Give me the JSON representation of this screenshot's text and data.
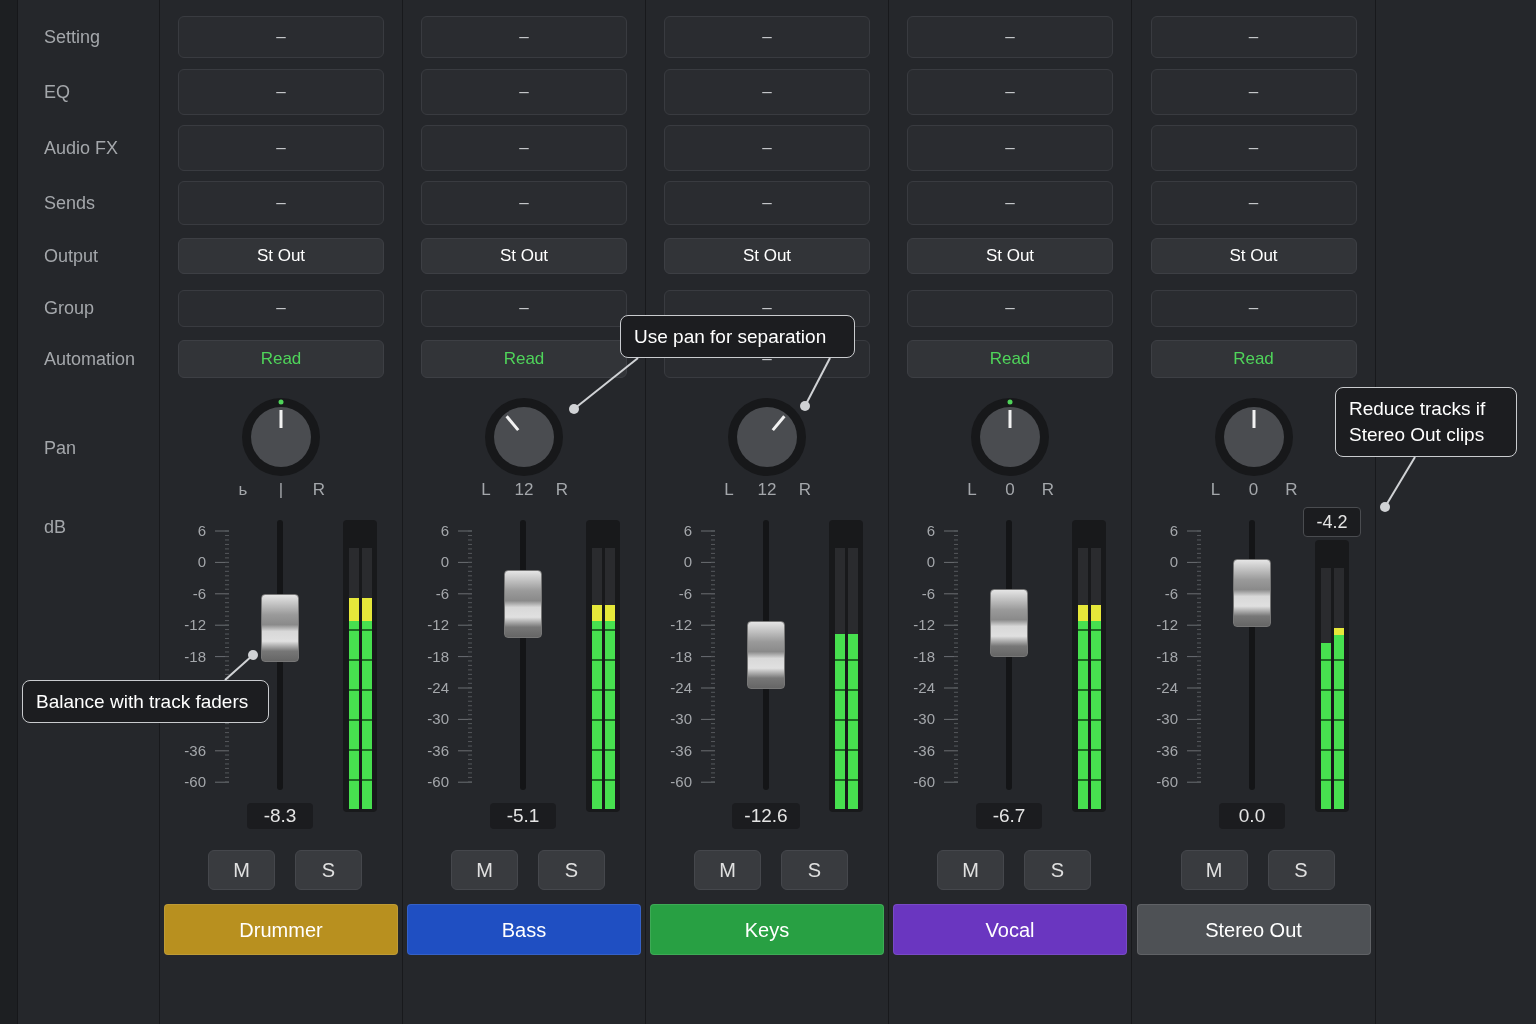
{
  "sidebar": {
    "labels": [
      "Setting",
      "EQ",
      "Audio FX",
      "Sends",
      "Output",
      "Group",
      "Automation",
      "Pan",
      "dB"
    ]
  },
  "channels": [
    {
      "name": "Drummer",
      "color": "#b8901f",
      "slots": [
        {
          "kind": "empty",
          "text": "–"
        },
        {
          "kind": "empty",
          "text": "–"
        },
        {
          "kind": "empty",
          "text": "–"
        },
        {
          "kind": "empty",
          "text": "–"
        },
        {
          "kind": "value",
          "text": "St Out"
        },
        {
          "kind": "empty",
          "text": "–"
        },
        {
          "kind": "automation",
          "text": "Read"
        }
      ],
      "pan": {
        "center_led": true,
        "labels": [
          "ь",
          "|",
          "R"
        ]
      },
      "scale": {
        "upper": [
          "6",
          "0",
          "-6",
          "-12",
          "-18"
        ],
        "lower": [
          "-36",
          "-60"
        ]
      },
      "fader": {
        "level": 0.6
      },
      "value": "-8.3",
      "buttons": [
        "M",
        "S"
      ]
    },
    {
      "name": "Bass",
      "color": "#1f4fc2",
      "slots": [
        {
          "kind": "empty",
          "text": "–"
        },
        {
          "kind": "empty",
          "text": "–"
        },
        {
          "kind": "empty",
          "text": "–"
        },
        {
          "kind": "empty",
          "text": "–"
        },
        {
          "kind": "value",
          "text": "St Out"
        },
        {
          "kind": "empty",
          "text": "–"
        },
        {
          "kind": "automation",
          "text": "Read"
        }
      ],
      "pan": {
        "center_led": false,
        "labels": [
          "L",
          "12",
          "R"
        ]
      },
      "scale": {
        "upper": [
          "6",
          "0",
          "-6",
          "-12",
          "-18",
          "-24",
          "-30"
        ],
        "lower": [
          "-36",
          "-60"
        ]
      },
      "fader": {
        "level": 0.69
      },
      "value": "-5.1",
      "buttons": [
        "M",
        "S"
      ]
    },
    {
      "name": "Keys",
      "color": "#28a043",
      "slots": [
        {
          "kind": "empty",
          "text": "–"
        },
        {
          "kind": "empty",
          "text": "–"
        },
        {
          "kind": "empty",
          "text": "–"
        },
        {
          "kind": "empty",
          "text": "–"
        },
        {
          "kind": "value",
          "text": "St Out"
        },
        {
          "kind": "empty",
          "text": "–"
        },
        {
          "kind": "empty",
          "text": "–"
        }
      ],
      "pan": {
        "center_led": false,
        "labels": [
          "L",
          "12",
          "R"
        ]
      },
      "scale": {
        "upper": [
          "6",
          "0",
          "-6",
          "-12",
          "-18",
          "-24",
          "-30"
        ],
        "lower": [
          "-36",
          "-60"
        ]
      },
      "fader": {
        "level": 0.5
      },
      "value": "-12.6",
      "buttons": [
        "M",
        "S"
      ]
    },
    {
      "name": "Vocal",
      "color": "#6a36c0",
      "slots": [
        {
          "kind": "empty",
          "text": "–"
        },
        {
          "kind": "empty",
          "text": "–"
        },
        {
          "kind": "empty",
          "text": "–"
        },
        {
          "kind": "empty",
          "text": "–"
        },
        {
          "kind": "value",
          "text": "St Out"
        },
        {
          "kind": "empty",
          "text": "–"
        },
        {
          "kind": "automation",
          "text": "Read"
        }
      ],
      "pan": {
        "center_led": true,
        "labels": [
          "L",
          "0",
          "R"
        ]
      },
      "scale": {
        "upper": [
          "6",
          "0",
          "-6",
          "-12",
          "-18",
          "-24",
          "-30"
        ],
        "lower": [
          "-36",
          "-60"
        ]
      },
      "fader": {
        "level": 0.62
      },
      "value": "-6.7",
      "buttons": [
        "M",
        "S"
      ]
    },
    {
      "name": "Stereo Out",
      "color": "#4e5155",
      "slots": [
        {
          "kind": "empty",
          "text": "–"
        },
        {
          "kind": "empty",
          "text": "–"
        },
        {
          "kind": "empty",
          "text": "–"
        },
        {
          "kind": "empty",
          "text": "–"
        },
        {
          "kind": "value",
          "text": "St Out"
        },
        {
          "kind": "empty",
          "text": "–"
        },
        {
          "kind": "automation",
          "text": "Read"
        }
      ],
      "pan": {
        "center_led": false,
        "labels": [
          "L",
          "0",
          "R"
        ]
      },
      "scale": {
        "upper": [
          "6",
          "0",
          "-6",
          "-12",
          "-18",
          "-24",
          "-30"
        ],
        "lower": [
          "-36",
          "-60"
        ]
      },
      "fader": {
        "level": 0.73
      },
      "value": "0.0",
      "peak": "-4.2",
      "buttons": [
        "M",
        "S"
      ]
    }
  ],
  "callouts": [
    {
      "text": "Balance with track faders"
    },
    {
      "text": "Use pan for separation"
    },
    {
      "text": "Reduce tracks if Stereo Out clips"
    }
  ]
}
